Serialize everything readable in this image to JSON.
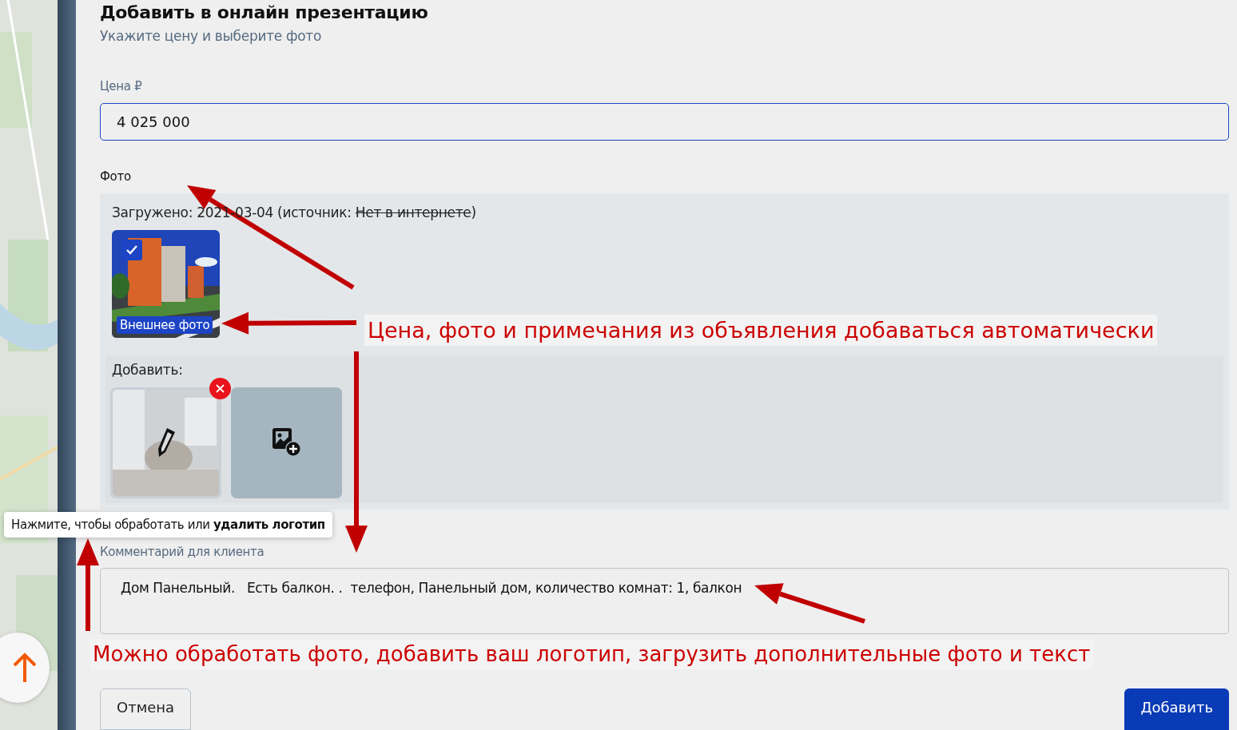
{
  "dialog": {
    "title": "Добавить в онлайн презентацию",
    "subtitle": "Укажите цену и выберите фото"
  },
  "price": {
    "label": "Цена ₽",
    "value": "4 025 000"
  },
  "photos": {
    "label": "Фото",
    "uploaded": "Загружено: 2021-03-04 (источник:",
    "source": "Нет в интернете",
    "source_struck": true,
    "closing": ")",
    "items": [
      {
        "kind": "listing",
        "checked": true,
        "tag": "Внешнее фото"
      }
    ]
  },
  "add": {
    "label": "Добавить:",
    "items": [
      {
        "kind": "logo",
        "removable": true
      },
      {
        "kind": "upload"
      }
    ]
  },
  "tooltip": "Нажмите, чтобы обработать или **удалить логотип**",
  "comment": {
    "label": "Комментарий для клиента",
    "value": "Дом Панельный.   Есть балкон. .  телефон, Панельный дом, количество комнат: 1, балкон"
  },
  "buttons": [
    {
      "kind": "secondary",
      "label": "Отмена"
    },
    {
      "kind": "primary",
      "label": "Добавить"
    }
  ],
  "annotations": [
    {
      "text": "Цена, фото и примечания из объявления добаваться автоматически"
    },
    {
      "text": "Можно обработать фото, добавить ваш логотип, загрузить дополнительные фото и текст"
    }
  ]
}
